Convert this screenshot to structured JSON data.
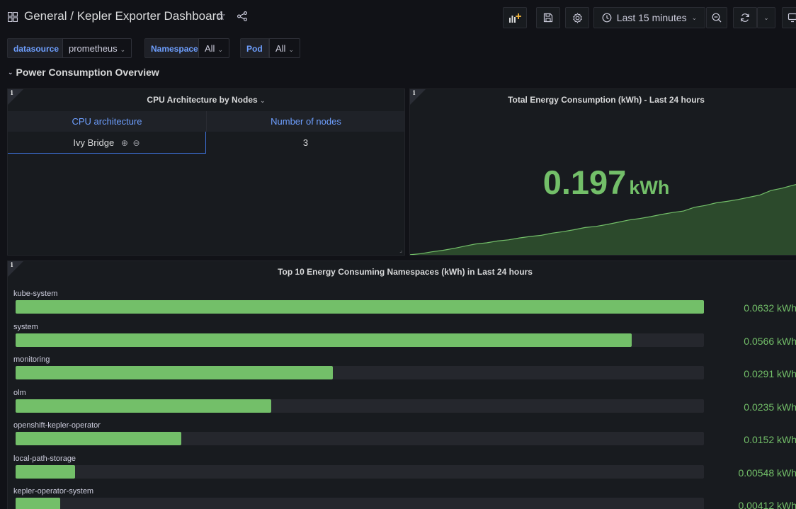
{
  "header": {
    "breadcrumb_folder": "General",
    "breadcrumb_separator": "/",
    "dashboard_title": "Kepler Exporter Dashboard",
    "time_range": "Last 15 minutes"
  },
  "variables": [
    {
      "label": "datasource",
      "value": "prometheus"
    },
    {
      "label": "Namespace",
      "value": "All"
    },
    {
      "label": "Pod",
      "value": "All"
    }
  ],
  "row": {
    "title": "Power Consumption Overview"
  },
  "panels": {
    "cpu_table": {
      "info": "i",
      "title": "CPU Architecture by Nodes",
      "columns": [
        "CPU architecture",
        "Number of nodes"
      ],
      "rows": [
        [
          "Ivy Bridge",
          "3"
        ]
      ]
    },
    "energy_stat": {
      "info": "i",
      "title": "Total Energy Consumption (kWh) - Last 24 hours",
      "value": "0.197",
      "unit": "kWh",
      "color": "#73bf69"
    },
    "top_namespaces": {
      "info": "i",
      "title": "Top 10 Energy Consuming Namespaces (kWh) in Last 24 hours",
      "max": 0.0632
    }
  },
  "chart_data": {
    "type": "bar",
    "categories": [
      "kube-system",
      "system",
      "monitoring",
      "olm",
      "openshift-kepler-operator",
      "local-path-storage",
      "kepler-operator-system"
    ],
    "values": [
      0.0632,
      0.0566,
      0.0291,
      0.0235,
      0.0152,
      0.00548,
      0.00412
    ],
    "labels": [
      "0.0632 kWh",
      "0.0566 kWh",
      "0.0291 kWh",
      "0.0235 kWh",
      "0.0152 kWh",
      "0.00548 kWh",
      "0.00412 kWh"
    ],
    "color": "#73bf69",
    "track_color": "#25272d"
  },
  "sparkline": {
    "values": [
      0.004,
      0.007,
      0.012,
      0.016,
      0.021,
      0.027,
      0.033,
      0.036,
      0.041,
      0.044,
      0.049,
      0.053,
      0.056,
      0.062,
      0.066,
      0.071,
      0.077,
      0.08,
      0.085,
      0.091,
      0.097,
      0.101,
      0.106,
      0.112,
      0.117,
      0.121,
      0.131,
      0.136,
      0.143,
      0.147,
      0.152,
      0.158,
      0.164,
      0.176,
      0.182,
      0.19,
      0.197
    ],
    "color": "#73bf69",
    "fill": "#2c4a2c"
  },
  "icons": {
    "dashboard": "grid-icon",
    "favorite": "star-icon",
    "share": "share-icon",
    "add_panel": "add-panel-icon",
    "save": "save-icon",
    "settings": "gear-icon",
    "time": "clock-icon",
    "zoom_out": "zoom-out-icon",
    "refresh": "refresh-icon",
    "refresh_interval": "chevron-down-icon",
    "tv_mode": "monitor-icon",
    "filter_in": "zoom-in-icon",
    "filter_out": "zoom-out-icon"
  }
}
